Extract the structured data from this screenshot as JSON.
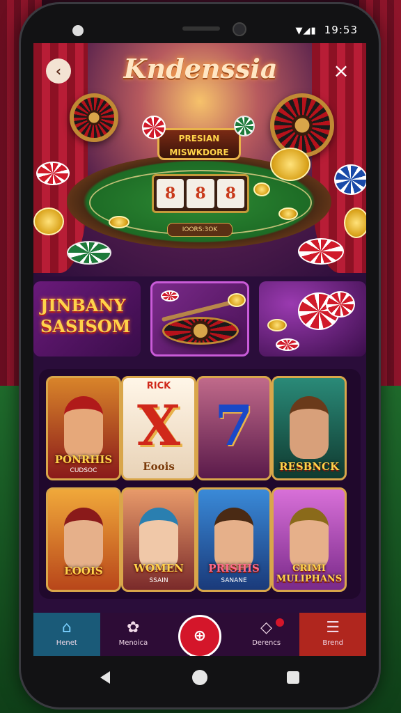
{
  "status": {
    "time": "19:53",
    "icons": "▼◢▮"
  },
  "header": {
    "title": "Kndenssia",
    "back_icon": "chevron-left-icon",
    "close_icon": "close-icon"
  },
  "hero": {
    "sign_text": "PRESIAN\nMISWKDORE",
    "reels": [
      "8",
      "8",
      "8"
    ],
    "plaque": "IOORS:3OK"
  },
  "banners": [
    {
      "text": "JINBANY SASISOM"
    },
    {
      "text": ""
    },
    {
      "text": ""
    }
  ],
  "games": [
    {
      "label": "PONRHIS",
      "sub": "CUDSOC",
      "bg": "#c0392b",
      "accent": "#d9a64a"
    },
    {
      "label": "Eoois",
      "top": "RICK",
      "glyph": "X",
      "bg": "#f4ece0",
      "accent": "#d0281a"
    },
    {
      "label": "",
      "glyph": "7",
      "bg": "#8a3a6a",
      "accent": "#1a48c8"
    },
    {
      "label": "RESBNCK",
      "bg": "#1f6a58",
      "accent": "#e8b24a"
    },
    {
      "label": "EOOIS",
      "bg": "#c85a1a",
      "accent": "#d9a64a"
    },
    {
      "label": "WOMEN",
      "sub": "SSAIN",
      "bg": "#b85a3a",
      "accent": "#2a7fb0"
    },
    {
      "label": "PRISHIS",
      "sub": "SANANE",
      "bg": "#2a6aa8",
      "accent": "#d83a5a"
    },
    {
      "label": "CRIMI MULIPHANS",
      "bg": "#a84aa8",
      "accent": "#e8b24a"
    }
  ],
  "nav": [
    {
      "label": "Henet",
      "icon": "home-icon",
      "glyph": "⌂"
    },
    {
      "label": "Menoica",
      "icon": "gamepad-icon",
      "glyph": "✿"
    },
    {
      "label": "",
      "icon": "play-button-icon",
      "glyph": "⊕"
    },
    {
      "label": "Derencs",
      "icon": "gem-icon",
      "glyph": "◇"
    },
    {
      "label": "Brend",
      "icon": "menu-icon",
      "glyph": "☰"
    }
  ]
}
